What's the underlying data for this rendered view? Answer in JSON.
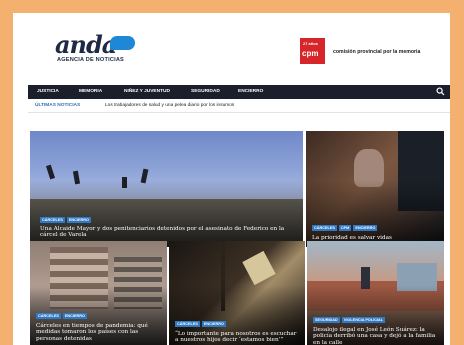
{
  "logo": {
    "word": "anda",
    "subtitle": "AGENCIA DE NOTICIAS"
  },
  "partner": {
    "box_top": "27 años",
    "box_main": "cpm",
    "name": "comisión provincial por la memoria"
  },
  "nav": {
    "items": [
      "JUSTICIA",
      "MEMORIA",
      "NIÑEZ Y JUVENTUD",
      "SEGURIDAD",
      "ENCIERRO"
    ],
    "search_icon": "search-icon"
  },
  "ticker": {
    "label": "ÚLTIMAS NOTICIAS",
    "text": "Los trabajadores de salud y una pelea diario por los insumos"
  },
  "cards": [
    {
      "tags": [
        "CÁRCELES",
        "ENCIERRO"
      ],
      "title": "Una Alcaide Mayor y dos penitenciarios detenidos por el asesinato de Federico en la cárcel de Varela"
    },
    {
      "tags": [
        "CÁRCELES",
        "CPM",
        "ENCIERRO"
      ],
      "title": "La prioridad es salvar vidas"
    },
    {
      "tags": [
        "CÁRCELES",
        "ENCIERRO"
      ],
      "title": "Cárceles en tiempos de pandemia: qué medidas tomaron los países con las personas detenidas"
    },
    {
      "tags": [
        "CÁRCELES",
        "ENCIERRO"
      ],
      "title": "“Lo importante para nosotros es escuchar a nuestros hijos decir ‘estamos bien’”"
    },
    {
      "tags": [
        "SEGURIDAD",
        "VIOLENCIA POLICIAL"
      ],
      "title": "Desalojo ilegal en José León Suárez: la policía derribó una casa y dejó a la familia en la calle"
    }
  ],
  "colors": {
    "accent": "#2f78c4",
    "nav_bg": "#1a1f2b",
    "frame": "#f4b06f",
    "cpm_red": "#d6262a"
  }
}
